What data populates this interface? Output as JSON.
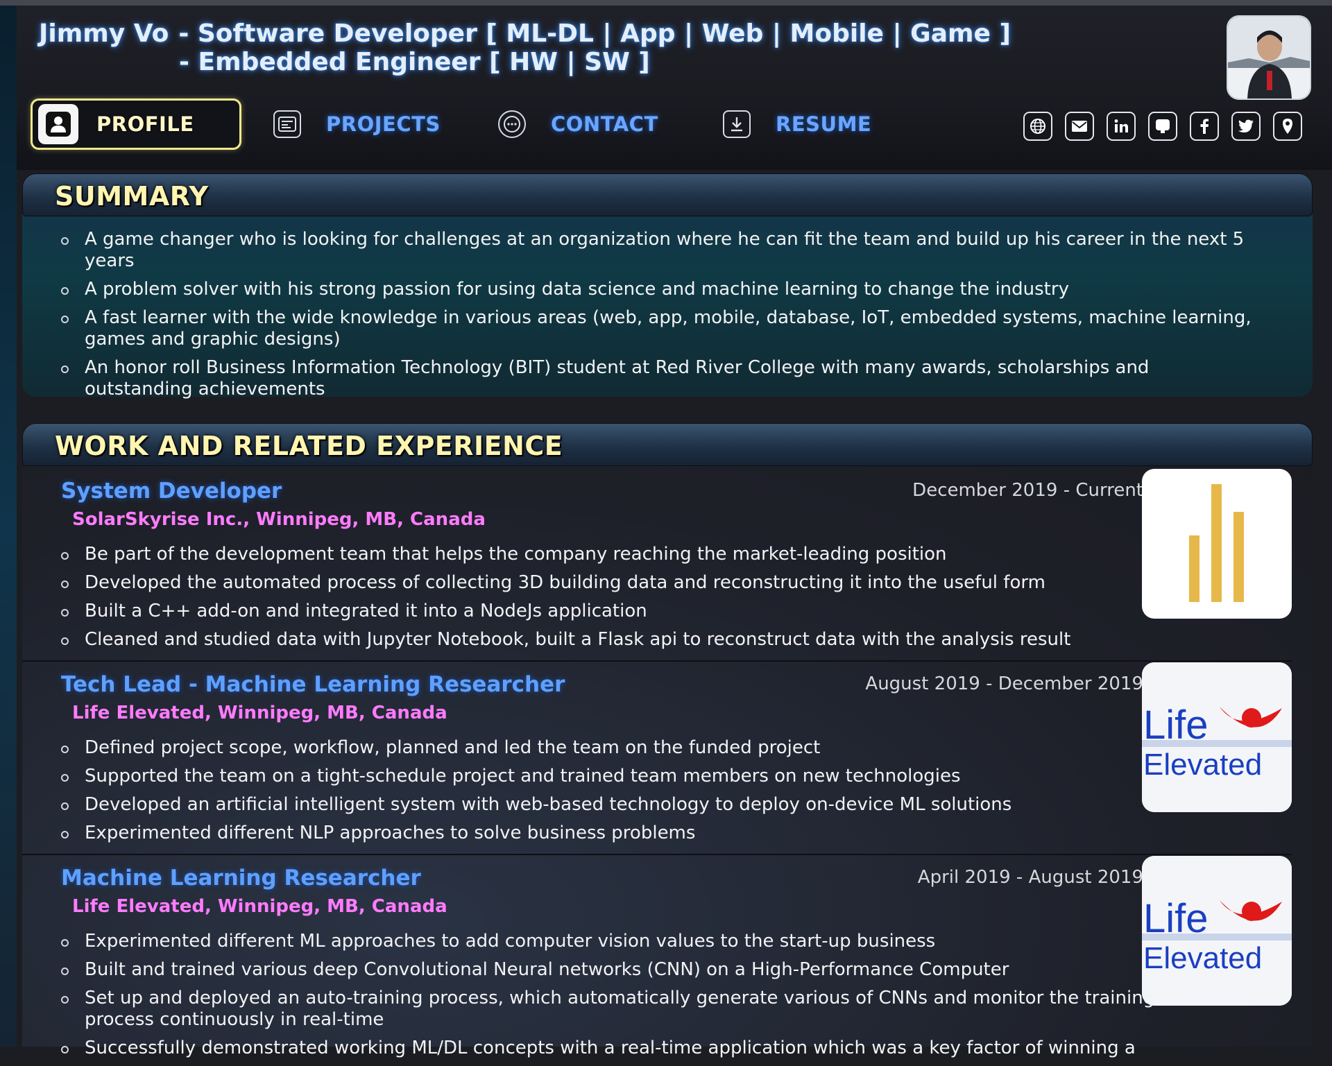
{
  "header": {
    "name": "Jimmy Vo",
    "line1": "- Software Developer [ ML-DL | App | Web | Mobile | Game ]",
    "line2": "- Embedded Engineer [ HW | SW ]"
  },
  "nav": [
    {
      "label": "PROFILE",
      "icon": "user-icon",
      "active": true
    },
    {
      "label": "PROJECTS",
      "icon": "projects-icon",
      "active": false
    },
    {
      "label": "CONTACT",
      "icon": "sms-icon",
      "active": false
    },
    {
      "label": "RESUME",
      "icon": "download-icon",
      "active": false
    }
  ],
  "social": [
    "globe-icon",
    "mail-icon",
    "linkedin-icon",
    "github-icon",
    "facebook-icon",
    "twitter-icon",
    "location-icon"
  ],
  "summary": {
    "title": "SUMMARY",
    "items": [
      "A game changer who is looking for challenges at an organization where he can fit the team and build up his career in the next 5 years",
      "A problem solver with his strong passion for using data science and machine learning to change the industry",
      "A fast learner with the wide knowledge in various areas (web, app, mobile, database, IoT, embedded systems, machine learning, games and graphic designs)",
      "An honor roll Business Information Technology (BIT) student at Red River College with many awards, scholarships and outstanding achievements"
    ]
  },
  "work": {
    "title": "WORK AND RELATED EXPERIENCE",
    "jobs": [
      {
        "title": "System Developer",
        "company": "SolarSkyrise Inc., Winnipeg, MB, Canada",
        "date": "December 2019 - Current",
        "logo": "solarskyrise-bars-logo",
        "items": [
          "Be part of the development team that helps the company reaching the market-leading position",
          "Developed the automated process of collecting 3D building data and reconstructing it into the useful form",
          "Built a C++ add-on and integrated it into a NodeJs application",
          "Cleaned and studied data with Jupyter Notebook, built a Flask api to reconstruct data with the analysis result"
        ]
      },
      {
        "title": "Tech Lead - Machine Learning Researcher",
        "company": "Life Elevated, Winnipeg, MB, Canada",
        "date": "August 2019 - December 2019",
        "logo_text": [
          "Life",
          "Elevated"
        ],
        "items": [
          "Defined project scope, workflow, planned and led the team on the funded project",
          "Supported the team on a tight-schedule project and trained team members on new technologies",
          "Developed an artificial intelligent system with web-based technology to deploy on-device ML solutions",
          "Experimented different NLP approaches to solve business problems"
        ]
      },
      {
        "title": "Machine Learning Researcher",
        "company": "Life Elevated, Winnipeg, MB, Canada",
        "date": "April 2019 - August 2019",
        "logo_text": [
          "Life",
          "Elevated"
        ],
        "items": [
          "Experimented different ML approaches to add computer vision values to the start-up business",
          "Built and trained various deep Convolutional Neural networks (CNN) on a High-Performance Computer",
          "Set up and deployed an auto-training process, which automatically generate various of CNNs and monitor the training process continuously in real-time",
          "Successfully demonstrated working ML/DL concepts with a real-time application which was a key factor of winning a"
        ]
      }
    ]
  },
  "colors": {
    "accent_yellow": "#f2e98a",
    "link_blue": "#6aa6ff",
    "company_pink": "#ff7bff",
    "solar_gold": "#e6b84a",
    "life_blue": "#1a3fc0",
    "life_red": "#e01a1a"
  }
}
